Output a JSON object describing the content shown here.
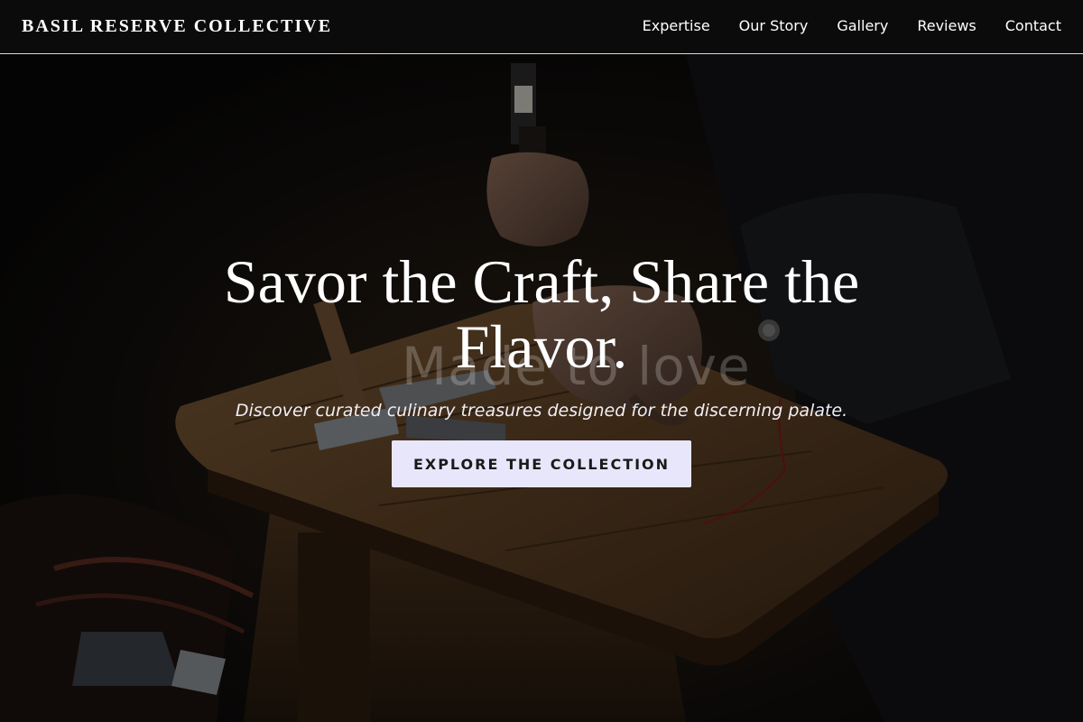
{
  "header": {
    "brand": "BASIL RESERVE COLLECTIVE",
    "nav": [
      {
        "label": "Expertise"
      },
      {
        "label": "Our Story"
      },
      {
        "label": "Gallery"
      },
      {
        "label": "Reviews"
      },
      {
        "label": "Contact"
      }
    ]
  },
  "hero": {
    "title": "Savor the Craft, Share the Flavor.",
    "ghost_text": "Made to love",
    "subtitle": "Discover curated culinary treasures designed for the discerning palate.",
    "cta_label": "EXPLORE THE COLLECTION"
  },
  "colors": {
    "nav_background": "#0b0b0b",
    "nav_border": "#d9d9d9",
    "text": "#ffffff",
    "cta_background": "#e8e6fb",
    "cta_text": "#1a1a1a"
  }
}
